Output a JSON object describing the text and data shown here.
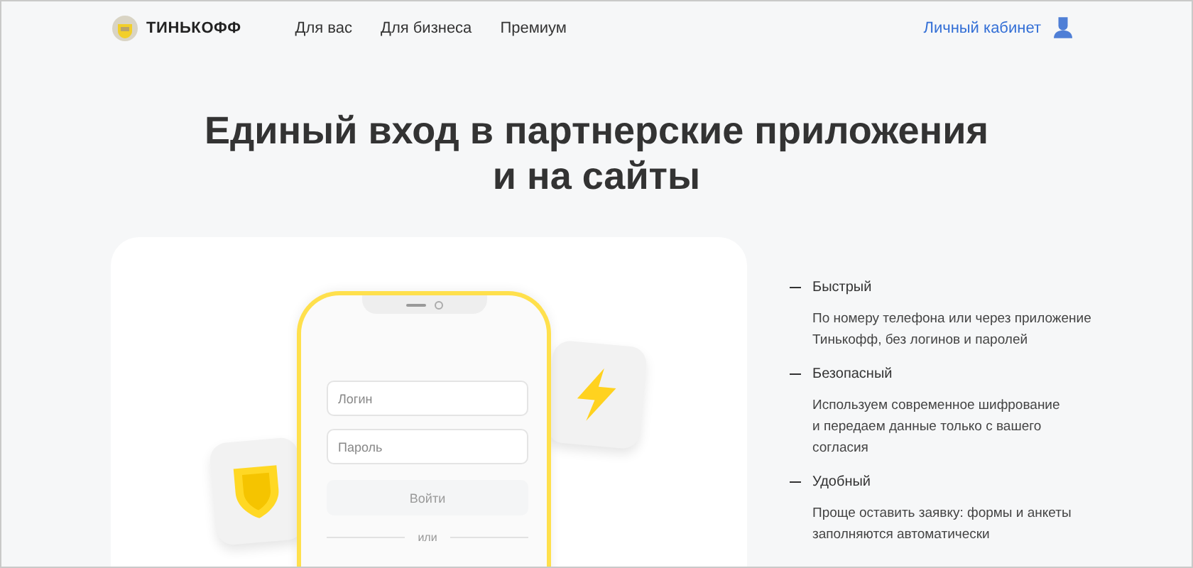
{
  "header": {
    "logo_text": "ТИНЬКОФФ",
    "nav": [
      {
        "label": "Для вас"
      },
      {
        "label": "Для бизнеса"
      },
      {
        "label": "Премиум"
      }
    ],
    "account_link": "Личный кабинет"
  },
  "title_lines": [
    "Единый вход в партнерские приложения",
    "и на сайты"
  ],
  "phone": {
    "fields": [
      {
        "placeholder": "Логин"
      },
      {
        "placeholder": "Пароль"
      }
    ],
    "button": {
      "label": "Войти",
      "disabled": true
    },
    "divider": "или"
  },
  "features": [
    {
      "title": "Быстрый",
      "text": "По номеру телефона или через приложение\nТинькофф, без логинов и паролей"
    },
    {
      "title": "Безопасный",
      "text": "Используем современное шифрование\nи передаем данные только с вашего\nсогласия"
    },
    {
      "title": "Удобный",
      "text": "Проще оставить заявку: формы и анкеты\nзаполняются автоматически"
    }
  ]
}
